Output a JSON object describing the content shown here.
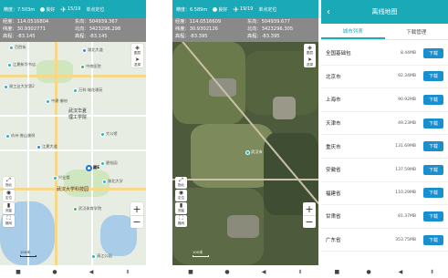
{
  "screens": [
    {
      "status": {
        "accuracy": "精度：7.503m",
        "state": "良好",
        "satellites": "15/19",
        "mode": "单点定位"
      },
      "coords": {
        "lon": "经度：114.0516804",
        "lat": "纬度：30.9302771",
        "height": "高程：-83.145",
        "east": "东向：504939.367",
        "north": "北向：3423296.298",
        "alt": "高程：-83.145"
      },
      "labels": {
        "poi1": "百胜街",
        "poi2": "湖北大道",
        "poi3": "江夏新华书店",
        "poi4": "中南医院",
        "poi5": "湖工业大学第2",
        "poi6": "万科·城花璟苑",
        "poi7": "中建·御府",
        "area1": "武汉华夏",
        "area2": "理工学院",
        "poi8": "玖州·香山美树",
        "poi9": "大公馆",
        "poi10": "江夏大道",
        "poi11": "碧桂园",
        "poi12": "兴业楼",
        "area3": "武汉大学科技园",
        "poi13": "湖北大学",
        "poi14": "武汉体育学院",
        "poi15": "清江公园",
        "user_marker": "藏E",
        "scale": "100米"
      },
      "controls": {
        "layer": "图层",
        "nav": "选择",
        "compass": "指北",
        "locate": "定位",
        "measure": "测量",
        "grid": "格网",
        "zoom_in": "+",
        "zoom_out": "−"
      }
    },
    {
      "status": {
        "accuracy": "精度：6.589m",
        "state": "良好",
        "satellites": "19/19",
        "mode": "单点定位"
      },
      "coords": {
        "lon": "经度：114.0516609",
        "lat": "纬度：30.9302126",
        "height": "高程：-83.395",
        "east": "东向：504939.677",
        "north": "北向：3423296.305",
        "alt": "高程：-83.395"
      },
      "labels": {
        "poi1": "武汉市",
        "scale": "100米"
      },
      "controls": {
        "layer": "图层",
        "nav": "选择",
        "compass": "指北",
        "locate": "定位",
        "measure": "测量",
        "grid": "格网",
        "zoom_in": "+",
        "zoom_out": "−"
      }
    }
  ],
  "offline": {
    "title": "离线地图",
    "back_icon": "‹",
    "tabs": [
      "城市列表",
      "下载管理"
    ],
    "download_label": "下载",
    "rows": [
      {
        "name": "全国基础包",
        "size": "8.44MB"
      },
      {
        "name": "北京市",
        "size": "92.34MB"
      },
      {
        "name": "上海市",
        "size": "90.92MB"
      },
      {
        "name": "天津市",
        "size": "49.23MB"
      },
      {
        "name": "重庆市",
        "size": "131.69MB"
      },
      {
        "name": "安徽省",
        "size": "137.59MB"
      },
      {
        "name": "福建省",
        "size": "110.29MB"
      },
      {
        "name": "甘肃省",
        "size": "81.37MB"
      },
      {
        "name": "广东省",
        "size": "353.75MB"
      }
    ]
  },
  "nav": {
    "menu": "■",
    "home": "●",
    "back": "◀",
    "extra": "⇟"
  },
  "colors": {
    "accent": "#1aa9b7",
    "button": "#1a8fd0"
  }
}
